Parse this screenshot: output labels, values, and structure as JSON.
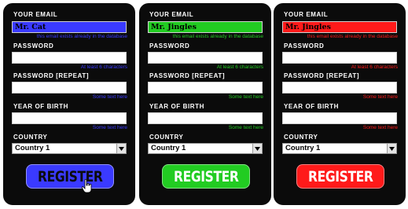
{
  "colors": {
    "page_background": "#ffffff",
    "panel_background": "#0b0b0b",
    "blue": "#3a3aff",
    "green": "#22cc22",
    "red": "#ff1a1a"
  },
  "panels": [
    {
      "variant": "blue",
      "email_label": "YOUR EMAIL",
      "email_value": "Mr. Cat",
      "email_hint": "this email exists already in the database",
      "password_label": "PASSWORD",
      "password_hint": "At least 6 characters",
      "password_repeat_label": "PASSWORD [REPEAT]",
      "password_repeat_hint": "Some text here",
      "birth_label": "YEAR OF BIRTH",
      "birth_hint": "Some text here",
      "country_label": "COUNTRY",
      "country_value": "Country 1",
      "register_label": "REGISTER",
      "accent": "#3a3aff",
      "button_text_color": "#0b0b0b"
    },
    {
      "variant": "green",
      "email_label": "YOUR EMAIL",
      "email_value": "Mr. Jingles",
      "email_hint": "this email exists already in the database",
      "password_label": "PASSWORD",
      "password_hint": "At least 6 characters",
      "password_repeat_label": "PASSWORD [REPEAT]",
      "password_repeat_hint": "Some text here",
      "birth_label": "YEAR OF BIRTH",
      "birth_hint": "Some text here",
      "country_label": "COUNTRY",
      "country_value": "Country 1",
      "register_label": "REGISTER",
      "accent": "#22cc22",
      "button_text_color": "#ffffff"
    },
    {
      "variant": "red",
      "email_label": "YOUR EMAIL",
      "email_value": "Mr. Jingles",
      "email_hint": "this email exists already in the database",
      "password_label": "PASSWORD",
      "password_hint": "At least 6 characters",
      "password_repeat_label": "PASSWORD [REPEAT]",
      "password_repeat_hint": "Some text here",
      "birth_label": "YEAR OF BIRTH",
      "birth_hint": "Some text here",
      "country_label": "COUNTRY",
      "country_value": "Country 1",
      "register_label": "REGISTER",
      "accent": "#ff1a1a",
      "button_text_color": "#ffffff"
    }
  ],
  "icons": {
    "select_arrow": "chevron-down-icon",
    "cursor": "pointer-cursor-icon"
  }
}
